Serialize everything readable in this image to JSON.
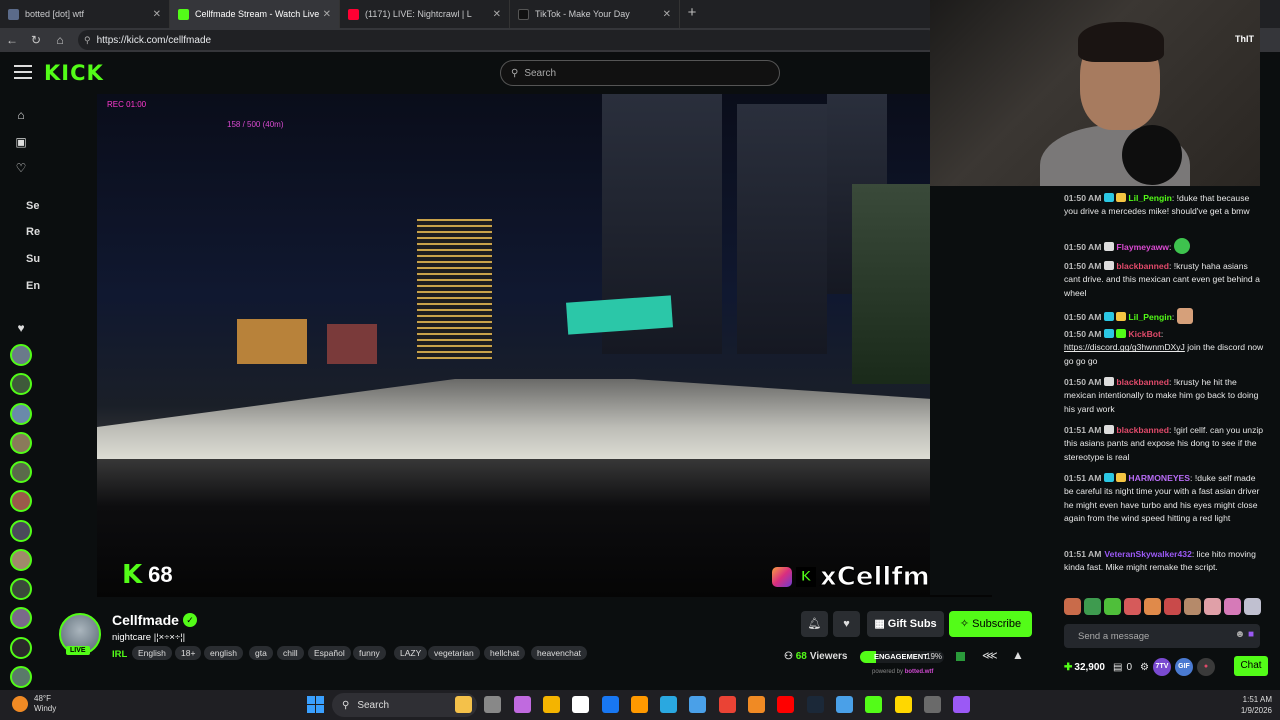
{
  "browser": {
    "tabs": [
      {
        "title": "botted [dot] wtf",
        "favicon_color": "#5b6b8a",
        "active": false
      },
      {
        "title": "Cellfmade Stream - Watch Live",
        "favicon_color": "#53fc18",
        "active": true
      },
      {
        "title": "(1171) LIVE: Nightcrawl | L",
        "favicon_color": "#ff0033",
        "active": false
      },
      {
        "title": "TikTok - Make Your Day",
        "favicon_color": "#111111",
        "active": false
      }
    ],
    "new_tab": "+",
    "url": "https://kick.com/cellfmade"
  },
  "kick": {
    "logo": "KICK",
    "search_placeholder": "Search",
    "sidebar_categories": [
      "Se",
      "Re",
      "Su",
      "En"
    ],
    "accent": "#53fc18"
  },
  "video": {
    "hud_top_left": "REC 01:00",
    "hud_counter": "158 / 500 (40m)",
    "viewer_count_overlay": "68",
    "overlay_name": "xCellfmade"
  },
  "webcam": {
    "overlay_text": "ThIT"
  },
  "chat": {
    "messages": [
      {
        "time": "01:50 AM",
        "user": "Lil_Pengin",
        "user_color": "#53fc18",
        "badges": [
          "#2bc7e3",
          "#f5c542"
        ],
        "text": "!duke that because you drive a mercedes mike! should've get a bmw"
      },
      {
        "time": "01:50 AM",
        "user": "Flaymeyaww",
        "user_color": "#d94ad1",
        "badges": [
          "#dddddd"
        ],
        "text": ""
      },
      {
        "time": "01:50 AM",
        "user": "blackbanned",
        "user_color": "#e04a6a",
        "badges": [
          "#dddddd"
        ],
        "text": "!krusty haha asians cant drive. and this mexican cant even get behind a wheel"
      },
      {
        "time": "01:50 AM",
        "user": "Lil_Pengin",
        "user_color": "#53fc18",
        "badges": [
          "#2bc7e3",
          "#f5c542"
        ],
        "text": ""
      },
      {
        "time": "01:50 AM",
        "user": "KickBot",
        "user_color": "#e04a6a",
        "badges": [
          "#2bc7e3",
          "#53fc18"
        ],
        "text": "join the discord now go go go",
        "link": "https://discord.gg/g3hwnmDXyJ"
      },
      {
        "time": "01:50 AM",
        "user": "blackbanned",
        "user_color": "#e04a6a",
        "badges": [
          "#dddddd"
        ],
        "text": "!krusty he hit the mexican intentionally to make him go back to doing his yard work"
      },
      {
        "time": "01:51 AM",
        "user": "blackbanned",
        "user_color": "#e04a6a",
        "badges": [
          "#dddddd"
        ],
        "text": "!girl cellf. can you unzip this asians pants and expose his dong to see if the stereotype is real"
      },
      {
        "time": "01:51 AM",
        "user": "HARMONEYES",
        "user_color": "#b86cf5",
        "badges": [
          "#2bc7e3",
          "#f5c542"
        ],
        "text": "!duke self made be careful its night time your with a fast asian driver he might even have turbo and his eyes might close again from the wind speed hitting a red light"
      },
      {
        "time": "01:51 AM",
        "user": "VeteranSkywalker432",
        "user_color": "#9b59f5",
        "badges": [],
        "text": "lice hito moving kinda fast. Mike might remake the script."
      }
    ],
    "emotes": [
      "#c96b4a",
      "#3e9b4f",
      "#4fbf3a",
      "#d65a5a",
      "#e08a4a",
      "#c94a4a",
      "#b58a6a",
      "#e0a0a8",
      "#d67ab8",
      "#c0c0d0"
    ],
    "input_placeholder": "Send a message",
    "points": "32,900",
    "vault_count": "0",
    "badge_7tv": "7TV",
    "badge_gif": "GIF",
    "chat_button": "Chat"
  },
  "stream": {
    "channel": "Cellfmade",
    "live_label": "LIVE",
    "title": "nightcare |¦×÷×÷¦|",
    "category": "IRL",
    "tags": [
      "English",
      "18+",
      "english",
      "gta",
      "chill",
      "Español",
      "funny",
      "LAZY",
      "vegetarian",
      "hellchat",
      "heavenchat"
    ],
    "gift_label": "Gift Subs",
    "subscribe_label": "Subscribe",
    "viewers": "68",
    "viewers_label": "Viewers",
    "engagement_label": "ENGAGEMENT",
    "engagement_pct": "19%",
    "engagement_value": 0.19,
    "powered_by": "powered by",
    "powered_brand": "botted.wtf"
  },
  "taskbar": {
    "weather_temp": "48°F",
    "weather_desc": "Windy",
    "search_label": "Search",
    "time": "1:51 AM",
    "date": "1/9/2026",
    "apps": [
      "#f4c14a",
      "#888888",
      "#c06adf",
      "#f4b400",
      "#ffffff",
      "#1877f2",
      "#ff9900",
      "#2aa8e0",
      "#4aa0e8",
      "#ea4335",
      "#f08a24",
      "#ff0000",
      "#1b2838",
      "#4aa0e8",
      "#53fc18",
      "#ffd700",
      "#6a6a6a",
      "#9b59f5"
    ]
  }
}
